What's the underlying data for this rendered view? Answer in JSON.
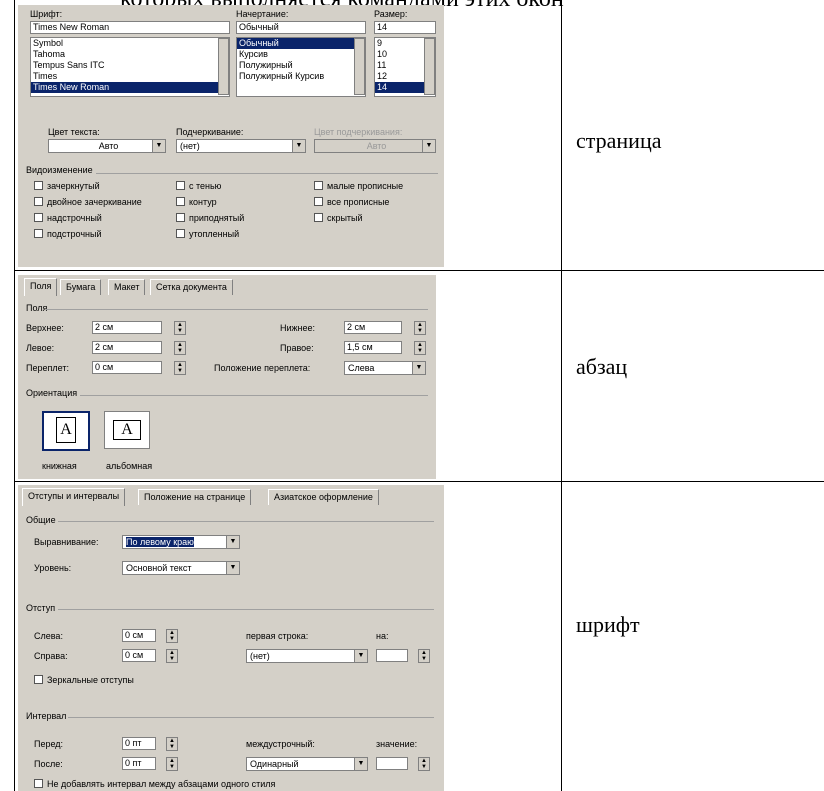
{
  "heading_fragment": "которых выполняется командами этих окон",
  "labels": [
    "страница",
    "абзац",
    "шрифт"
  ],
  "font_dialog": {
    "font_label": "Шрифт:",
    "style_label": "Начертание:",
    "size_label": "Размер:",
    "font_value": "Times New Roman",
    "style_value": "Обычный",
    "size_value": "14",
    "font_list": [
      "Symbol",
      "Tahoma",
      "Tempus Sans ITC",
      "Times",
      "Times New Roman"
    ],
    "style_list": [
      "Обычный",
      "Курсив",
      "Полужирный",
      "Полужирный Курсив"
    ],
    "size_list": [
      "9",
      "10",
      "11",
      "12",
      "14"
    ],
    "color_label": "Цвет текста:",
    "color_value": "Авто",
    "underline_label": "Подчеркивание:",
    "underline_value": "(нет)",
    "underline_color_label": "Цвет подчеркивания:",
    "underline_color_value": "Авто",
    "effects_label": "Видоизменение",
    "effects": [
      "зачеркнутый",
      "двойное зачеркивание",
      "надстрочный",
      "подстрочный",
      "с тенью",
      "контур",
      "приподнятый",
      "утопленный",
      "малые прописные",
      "все прописные",
      "скрытый"
    ]
  },
  "page_dialog": {
    "tabs": [
      "Поля",
      "Бумага",
      "Макет",
      "Сетка документа"
    ],
    "margins_label": "Поля",
    "top_label": "Верхнее:",
    "top_value": "2 см",
    "bottom_label": "Нижнее:",
    "bottom_value": "2 см",
    "left_label": "Левое:",
    "left_value": "2 см",
    "right_label": "Правое:",
    "right_value": "1,5 см",
    "gutter_label": "Переплет:",
    "gutter_value": "0 см",
    "gutter_pos_label": "Положение переплета:",
    "gutter_pos_value": "Слева",
    "orientation_label": "Ориентация",
    "portrait_label": "книжная",
    "landscape_label": "альбомная",
    "icon_letter": "A"
  },
  "para_dialog": {
    "tabs": [
      "Отступы и интервалы",
      "Положение на странице",
      "Азиатское оформление"
    ],
    "general_label": "Общие",
    "align_label": "Выравнивание:",
    "align_value": "По левому краю",
    "level_label": "Уровень:",
    "level_value": "Основной текст",
    "indent_label": "Отступ",
    "indent_left_label": "Слева:",
    "indent_left_value": "0 см",
    "indent_right_label": "Справа:",
    "indent_right_value": "0 см",
    "first_line_label": "первая строка:",
    "first_line_value": "(нет)",
    "on_label": "на:",
    "mirror_label": "Зеркальные отступы",
    "spacing_label": "Интервал",
    "before_label": "Перед:",
    "before_value": "0 пт",
    "after_label": "После:",
    "after_value": "0 пт",
    "line_spacing_label": "междустрочный:",
    "line_spacing_value": "Одинарный",
    "value_label": "значение:",
    "no_space_label": "Не добавлять интервал между абзацами одного стиля"
  }
}
